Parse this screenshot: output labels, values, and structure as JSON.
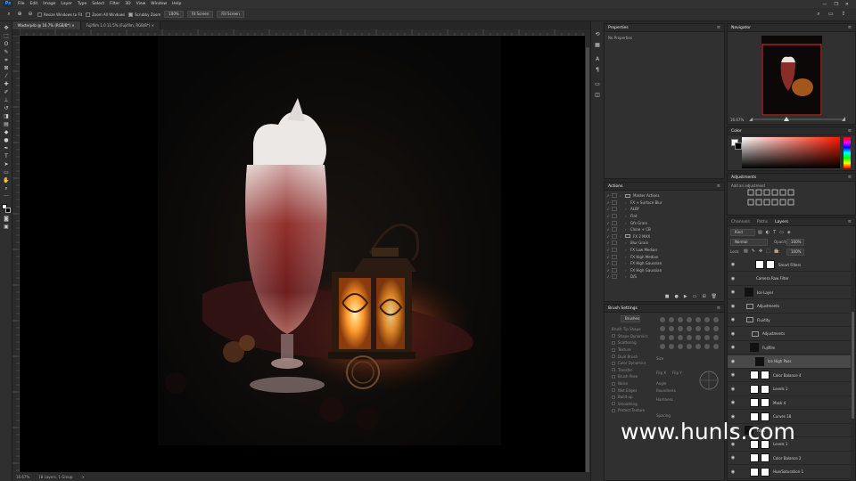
{
  "app_logo": "Ps",
  "menu": [
    "File",
    "Edit",
    "Image",
    "Layer",
    "Type",
    "Select",
    "Filter",
    "3D",
    "View",
    "Window",
    "Help"
  ],
  "window_controls": [
    "—",
    "❐",
    "✕"
  ],
  "options": {
    "resize_windows": "Resize Windows to Fit",
    "zoom_all": "Zoom All Windows",
    "scrubby_zoom": "Scrubby Zoom",
    "zoom_100": "100%",
    "fit_screen": "Fit Screen",
    "fill_screen": "Fill Screen"
  },
  "tabs": [
    {
      "label": "Masterpsb @ 16.7% (RGB/8*) ×"
    },
    {
      "label": "Fujifilm 1.0 11.5% (Fujifilm, RGB/8*) ×"
    }
  ],
  "status": {
    "zoom": "16.67%",
    "info": "18 Layers, 1 Group",
    "arrow": ">"
  },
  "properties": {
    "title": "Properties",
    "empty_text": "No Properties"
  },
  "navigator": {
    "title": "Navigator",
    "zoom": "16.67%"
  },
  "color_panel": {
    "title": "Color",
    "fg_color": "#ffffff",
    "bg_color": "#000000",
    "hue_color": "#ff1a00"
  },
  "adjustments": {
    "title": "Adjustments",
    "subtitle": "Add an adjustment"
  },
  "actions": {
    "title": "Actions",
    "items": [
      {
        "label": "Master Actions",
        "type": "set"
      },
      {
        "label": "FX + Surface Blur",
        "type": "action"
      },
      {
        "label": "ALBY",
        "type": "action"
      },
      {
        "label": "Flat",
        "type": "action"
      },
      {
        "label": "Gfx Grain",
        "type": "action"
      },
      {
        "label": "Clone + CB",
        "type": "action"
      },
      {
        "label": "FX 2 MAX",
        "type": "set"
      },
      {
        "label": "Blur Grain",
        "type": "action"
      },
      {
        "label": "FX Low Median",
        "type": "action"
      },
      {
        "label": "FX High Median",
        "type": "action"
      },
      {
        "label": "FX High Gaussian",
        "type": "action"
      },
      {
        "label": "FX High Gaussian",
        "type": "action"
      },
      {
        "label": "D/S",
        "type": "action"
      }
    ]
  },
  "brush_settings": {
    "title": "Brush Settings",
    "brushes_btn": "Brushes",
    "items": [
      "Brush Tip Shape",
      "Shape Dynamics",
      "Scattering",
      "Texture",
      "Dual Brush",
      "Color Dynamics",
      "Transfer",
      "Brush Pose",
      "Noise",
      "Wet Edges",
      "Build-up",
      "Smoothing",
      "Protect Texture"
    ],
    "size_label": "Size",
    "flip_x": "Flip X",
    "flip_y": "Flip Y",
    "angle_label": "Angle",
    "roundness_label": "Roundness",
    "hardness_label": "Hardness",
    "spacing_label": "Spacing"
  },
  "layers": {
    "tabs": [
      "Channels",
      "Paths",
      "Layers"
    ],
    "kind": "Kind",
    "mode": "Normal",
    "opacity_label": "Opacity:",
    "opacity": "100%",
    "lock_label": "Lock:",
    "fill_label": "Fill:",
    "fill": "100%",
    "items": [
      {
        "label": "Smart Filters",
        "thumb": "white",
        "indent": 3
      },
      {
        "label": "Camera Raw Filter",
        "thumb": "none",
        "indent": 3
      },
      {
        "label": "Ice Layer",
        "thumb": "dark",
        "indent": 1
      },
      {
        "label": "Adjustments",
        "thumb": "folder",
        "indent": 1
      },
      {
        "label": "Fluidity",
        "thumb": "folder",
        "indent": 1
      },
      {
        "label": "Adjustments",
        "thumb": "folder",
        "indent": 2
      },
      {
        "label": "Fujifilm",
        "thumb": "dark",
        "indent": 2
      },
      {
        "label": "Ice High Pass",
        "thumb": "dark",
        "indent": 3,
        "selected": true
      },
      {
        "label": "Color Balance 4",
        "thumb": "white",
        "indent": 2
      },
      {
        "label": "Levels 1",
        "thumb": "white",
        "indent": 2
      },
      {
        "label": "Mask 4",
        "thumb": "white",
        "indent": 2
      },
      {
        "label": "Curves 18",
        "thumb": "white",
        "indent": 2
      },
      {
        "label": "Fill 1",
        "thumb": "dark",
        "indent": 1
      },
      {
        "label": "Levels 1",
        "thumb": "white",
        "indent": 2
      },
      {
        "label": "Color Balance 2",
        "thumb": "white",
        "indent": 2
      },
      {
        "label": "Hue/Saturation 1",
        "thumb": "white",
        "indent": 2
      }
    ]
  },
  "watermark": "www.hunls.com"
}
